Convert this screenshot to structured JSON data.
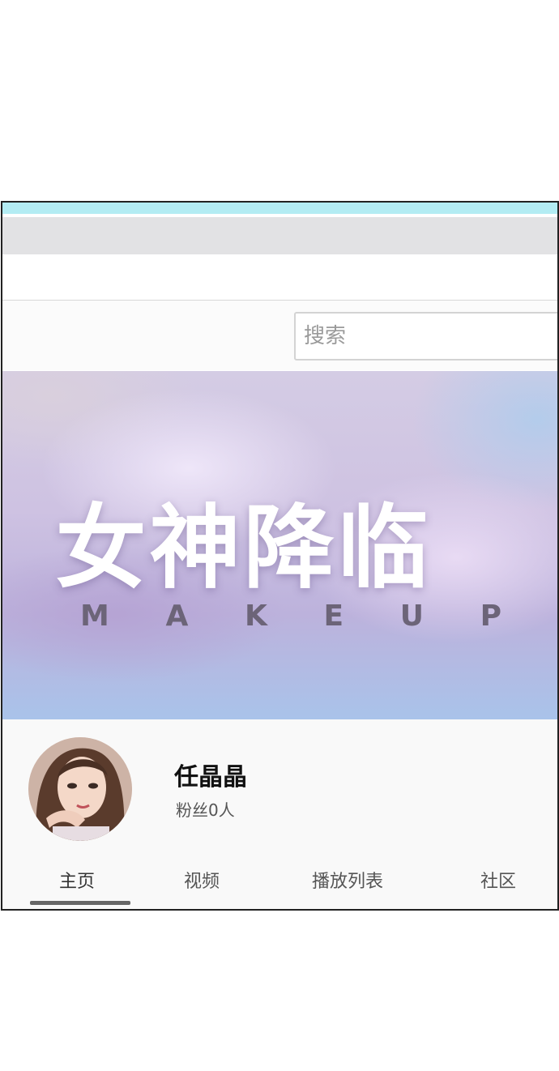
{
  "search": {
    "placeholder": "搜索",
    "value": ""
  },
  "banner": {
    "title": "女神降临",
    "subtitle_letters": [
      "M",
      "A",
      "K",
      "E",
      "U",
      "P"
    ]
  },
  "channel": {
    "name": "任晶晶",
    "subscribers": "粉丝0人"
  },
  "tabs": [
    {
      "label": "主页",
      "active": true
    },
    {
      "label": "视频",
      "active": false
    },
    {
      "label": "播放列表",
      "active": false
    },
    {
      "label": "社区",
      "active": false
    }
  ],
  "colors": {
    "top_accent": "#b3ecf3",
    "toolbar_gray": "#e2e2e4",
    "active_tab_underline": "#666666"
  }
}
